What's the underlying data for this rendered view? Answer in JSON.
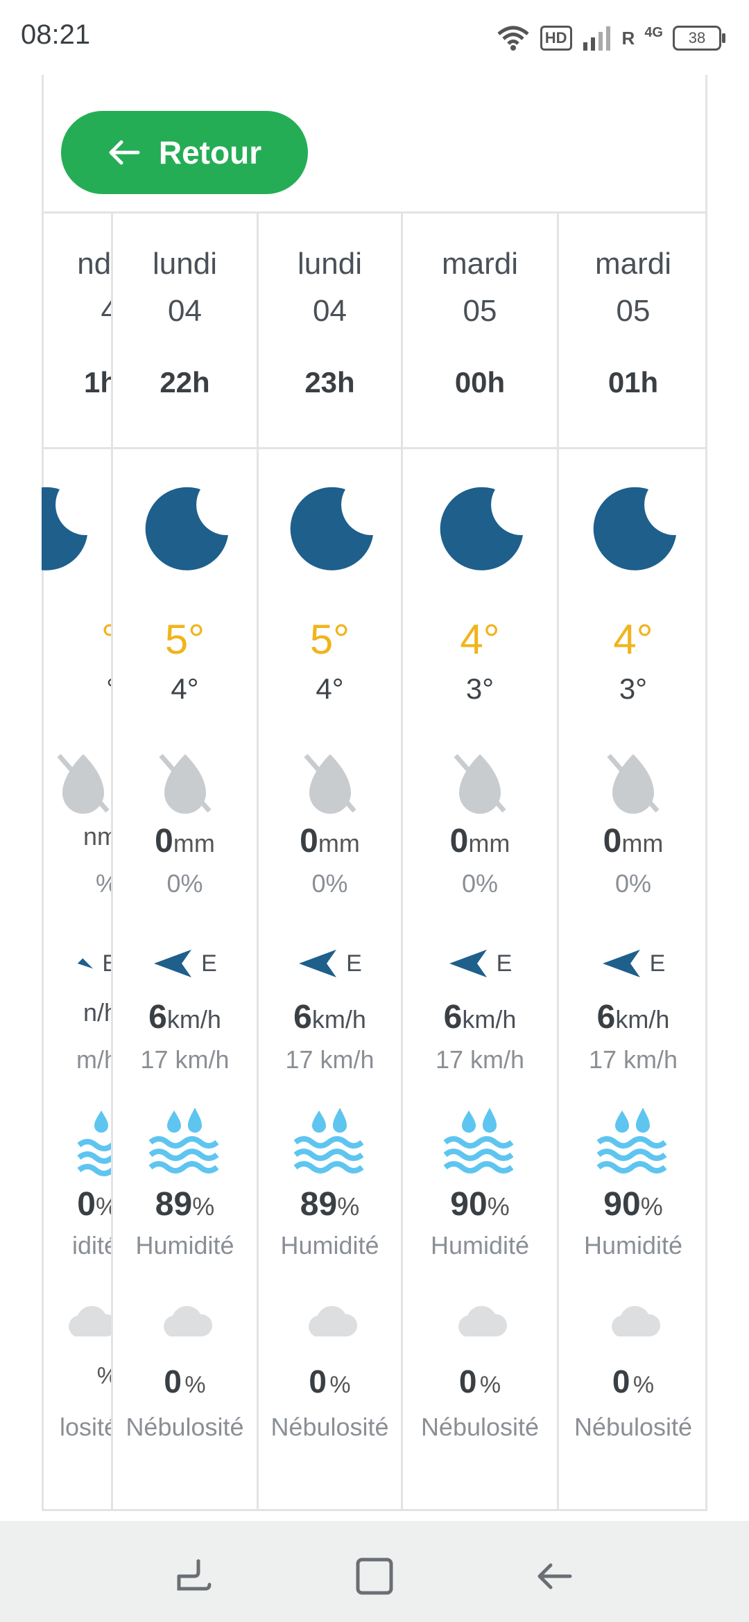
{
  "status_bar": {
    "time": "08:21",
    "hd": "HD",
    "roaming": "R",
    "network": "4G",
    "battery": "38"
  },
  "back_button": {
    "label": "Retour",
    "color": "#25ad56"
  },
  "colors": {
    "temperature": "#f0b41c",
    "moon": "#1e5f8c",
    "humidity": "#5ec5f0",
    "grid": "#e3e3e3"
  },
  "partial_column": {
    "day": "ndi",
    "date": "4",
    "hour": "1h",
    "temp": "°",
    "temp_feel": "°",
    "rain": "nm",
    "rain_prob": "%",
    "wind_dir": "E",
    "wind_speed": "n/h",
    "gust": "m/h",
    "humidity": "0",
    "humidity_unit": "%",
    "humidity_label": "idité",
    "cloud_unit": "%",
    "cloud_label": "losité"
  },
  "forecast": [
    {
      "day": "lundi",
      "date": "04",
      "hour": "22h",
      "temp": "5°",
      "temp_feel": "4°",
      "rain_value": "0",
      "rain_unit": "mm",
      "rain_prob": "0%",
      "wind_dir": "E",
      "wind_speed": "6",
      "wind_unit": "km/h",
      "gust": "17 km/h",
      "humidity": "89",
      "humidity_unit": "%",
      "humidity_label": "Humidité",
      "cloud": "0",
      "cloud_unit": "%",
      "cloud_label": "Nébulosité"
    },
    {
      "day": "lundi",
      "date": "04",
      "hour": "23h",
      "temp": "5°",
      "temp_feel": "4°",
      "rain_value": "0",
      "rain_unit": "mm",
      "rain_prob": "0%",
      "wind_dir": "E",
      "wind_speed": "6",
      "wind_unit": "km/h",
      "gust": "17 km/h",
      "humidity": "89",
      "humidity_unit": "%",
      "humidity_label": "Humidité",
      "cloud": "0",
      "cloud_unit": "%",
      "cloud_label": "Nébulosité"
    },
    {
      "day": "mardi",
      "date": "05",
      "hour": "00h",
      "temp": "4°",
      "temp_feel": "3°",
      "rain_value": "0",
      "rain_unit": "mm",
      "rain_prob": "0%",
      "wind_dir": "E",
      "wind_speed": "6",
      "wind_unit": "km/h",
      "gust": "17 km/h",
      "humidity": "90",
      "humidity_unit": "%",
      "humidity_label": "Humidité",
      "cloud": "0",
      "cloud_unit": "%",
      "cloud_label": "Nébulosité"
    },
    {
      "day": "mardi",
      "date": "05",
      "hour": "01h",
      "temp": "4°",
      "temp_feel": "3°",
      "rain_value": "0",
      "rain_unit": "mm",
      "rain_prob": "0%",
      "wind_dir": "E",
      "wind_speed": "6",
      "wind_unit": "km/h",
      "gust": "17 km/h",
      "humidity": "90",
      "humidity_unit": "%",
      "humidity_label": "Humidité",
      "cloud": "0",
      "cloud_unit": "%",
      "cloud_label": "Nébulosité"
    }
  ],
  "nav_bar": {
    "items": [
      "recent-apps-icon",
      "home-icon",
      "back-icon"
    ]
  }
}
